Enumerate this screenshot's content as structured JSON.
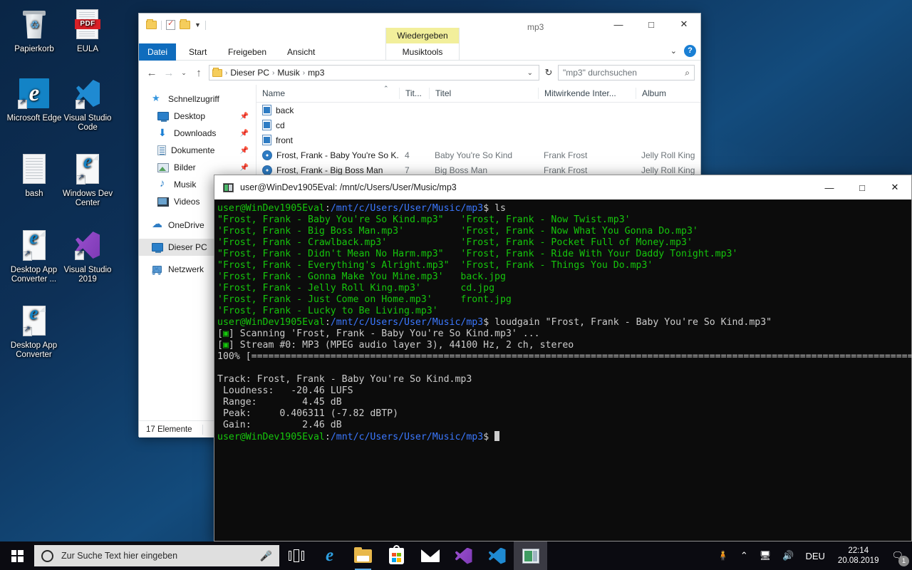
{
  "desktop": {
    "icons": [
      {
        "name": "Papierkorb",
        "type": "trash"
      },
      {
        "name": "EULA",
        "type": "pdf"
      },
      {
        "name": "Microsoft Edge",
        "type": "edge-tile"
      },
      {
        "name": "Visual Studio Code",
        "type": "vscode"
      },
      {
        "name": "bash",
        "type": "doc"
      },
      {
        "name": "Windows Dev Center",
        "type": "edge-file"
      },
      {
        "name": "Desktop App Converter ...",
        "type": "edge-file"
      },
      {
        "name": "Visual Studio 2019",
        "type": "visualstudio"
      },
      {
        "name": "Desktop App Converter",
        "type": "edge-file"
      }
    ]
  },
  "explorer": {
    "title": "mp3",
    "quick_access_toolbar": [
      "folder-icon",
      "properties-icon",
      "new-folder-icon",
      "customize-chevron-icon"
    ],
    "window_buttons": {
      "minimize": "—",
      "maximize": "□",
      "close": "✕"
    },
    "ribbon": {
      "tabs": [
        "Datei",
        "Start",
        "Freigeben",
        "Ansicht"
      ],
      "contextual_group_header": "Wiedergeben",
      "contextual_group_label": "Musiktools",
      "collapse_icon": "chevron-down-icon",
      "help_label": "?"
    },
    "address": {
      "back": "←",
      "forward": "→",
      "recent": "⌄",
      "up": "↑",
      "breadcrumb": [
        "Dieser PC",
        "Musik",
        "mp3"
      ],
      "dropdown": "⌄",
      "refresh": "↻"
    },
    "search": {
      "placeholder": "\"mp3\" durchsuchen",
      "value": "",
      "icon": "search-icon"
    },
    "nav_pane": [
      {
        "label": "Schnellzugriff",
        "icon": "star-icon",
        "indent": false,
        "pinned": false,
        "selected": false
      },
      {
        "label": "Desktop",
        "icon": "monitor-icon",
        "indent": true,
        "pinned": true,
        "selected": false
      },
      {
        "label": "Downloads",
        "icon": "download-icon",
        "indent": true,
        "pinned": true,
        "selected": false
      },
      {
        "label": "Dokumente",
        "icon": "document-icon",
        "indent": true,
        "pinned": true,
        "selected": false
      },
      {
        "label": "Bilder",
        "icon": "pictures-icon",
        "indent": true,
        "pinned": true,
        "selected": false
      },
      {
        "label": "Musik",
        "icon": "music-note-icon",
        "indent": true,
        "pinned": false,
        "selected": false
      },
      {
        "label": "Videos",
        "icon": "video-icon",
        "indent": true,
        "pinned": false,
        "selected": false
      },
      {
        "label": "OneDrive",
        "icon": "cloud-icon",
        "indent": false,
        "pinned": false,
        "selected": false
      },
      {
        "label": "Dieser PC",
        "icon": "monitor-icon",
        "indent": false,
        "pinned": false,
        "selected": true
      },
      {
        "label": "Netzwerk",
        "icon": "network-icon",
        "indent": false,
        "pinned": false,
        "selected": false
      }
    ],
    "columns": [
      "Name",
      "Tit...",
      "Titel",
      "Mitwirkende Inter...",
      "Album"
    ],
    "sort_indicator": "⌃",
    "files": [
      {
        "icon": "jpg-file-icon",
        "name": "back",
        "track": "",
        "title": "",
        "artist": "",
        "album": ""
      },
      {
        "icon": "jpg-file-icon",
        "name": "cd",
        "track": "",
        "title": "",
        "artist": "",
        "album": ""
      },
      {
        "icon": "jpg-file-icon",
        "name": "front",
        "track": "",
        "title": "",
        "artist": "",
        "album": ""
      },
      {
        "icon": "mp3-file-icon",
        "name": "Frost, Frank - Baby You're So K...",
        "track": "4",
        "title": "Baby You're So Kind",
        "artist": "Frank Frost",
        "album": "Jelly Roll King"
      },
      {
        "icon": "mp3-file-icon",
        "name": "Frost, Frank - Big Boss Man",
        "track": "7",
        "title": "Big Boss Man",
        "artist": "Frank Frost",
        "album": "Jelly Roll King"
      }
    ],
    "status": "17 Elemente"
  },
  "terminal": {
    "title": "user@WinDev1905Eval: /mnt/c/Users/User/Music/mp3",
    "icon": "terminal-icon",
    "window_buttons": {
      "minimize": "—",
      "maximize": "□",
      "close": "✕"
    },
    "prompt_user": "user@WinDev1905Eval",
    "prompt_path": "/mnt/c/Users/User/Music/mp3",
    "prompt_sym": "$ ",
    "command1": "ls",
    "ls_left": [
      "\"Frost, Frank - Baby You're So Kind.mp3\"",
      "'Frost, Frank - Big Boss Man.mp3'",
      "'Frost, Frank - Crawlback.mp3'",
      "\"Frost, Frank - Didn't Mean No Harm.mp3\"",
      "\"Frost, Frank - Everything's Alright.mp3\"",
      "'Frost, Frank - Gonna Make You Mine.mp3'",
      "'Frost, Frank - Jelly Roll King.mp3'",
      "'Frost, Frank - Just Come on Home.mp3'",
      "'Frost, Frank - Lucky to Be Living.mp3'"
    ],
    "ls_right": [
      "'Frost, Frank - Now Twist.mp3'",
      "'Frost, Frank - Now What You Gonna Do.mp3'",
      "'Frost, Frank - Pocket Full of Money.mp3'",
      "'Frost, Frank - Ride With Your Daddy Tonight.mp3'",
      "'Frost, Frank - Things You Do.mp3'",
      "back.jpg",
      "cd.jpg",
      "front.jpg",
      ""
    ],
    "command2": "loudgain \"Frost, Frank - Baby You're So Kind.mp3\"",
    "scan_line": "] Scanning 'Frost, Frank - Baby You're So Kind.mp3' ...",
    "stream_line": "] Stream #0: MP3 (MPEG audio layer 3), 44100 Hz, 2 ch, stereo",
    "progress_label": "100% ",
    "progress_bar": "[==================================================================================================================================================================================]",
    "result_track": "Track: Frost, Frank - Baby You're So Kind.mp3",
    "result_rows": [
      " Loudness:   -20.46 LUFS",
      " Range:        4.45 dB",
      " Peak:     0.406311 (-7.82 dBTP)",
      " Gain:         2.46 dB"
    ]
  },
  "taskbar": {
    "start_icon": "windows-logo-icon",
    "search_placeholder": "Zur Suche Text hier eingeben",
    "search_value": "",
    "search_icon": "circle-search-icon",
    "mic_icon": "microphone-icon",
    "buttons": [
      {
        "name": "task-view",
        "icon": "task-view-icon",
        "active": false,
        "running": false
      },
      {
        "name": "microsoft-edge",
        "icon": "edge-icon",
        "active": false,
        "running": false
      },
      {
        "name": "file-explorer",
        "icon": "folder-icon",
        "active": false,
        "running": true
      },
      {
        "name": "microsoft-store",
        "icon": "store-icon",
        "active": false,
        "running": false
      },
      {
        "name": "mail",
        "icon": "mail-icon",
        "active": false,
        "running": false
      },
      {
        "name": "visual-studio",
        "icon": "visual-studio-icon",
        "active": false,
        "running": false
      },
      {
        "name": "visual-studio-code",
        "icon": "vscode-icon",
        "active": false,
        "running": false
      },
      {
        "name": "terminal",
        "icon": "terminal-icon",
        "active": true,
        "running": true
      }
    ],
    "tray": {
      "people_icon": "people-icon",
      "chevron_icon": "show-hidden-icons-chevron",
      "network_icon": "network-icon",
      "volume_icon": "volume-icon",
      "language": "DEU",
      "time": "22:14",
      "date": "20.08.2019",
      "action_center_icon": "action-center-icon",
      "notification_count": "1"
    }
  }
}
